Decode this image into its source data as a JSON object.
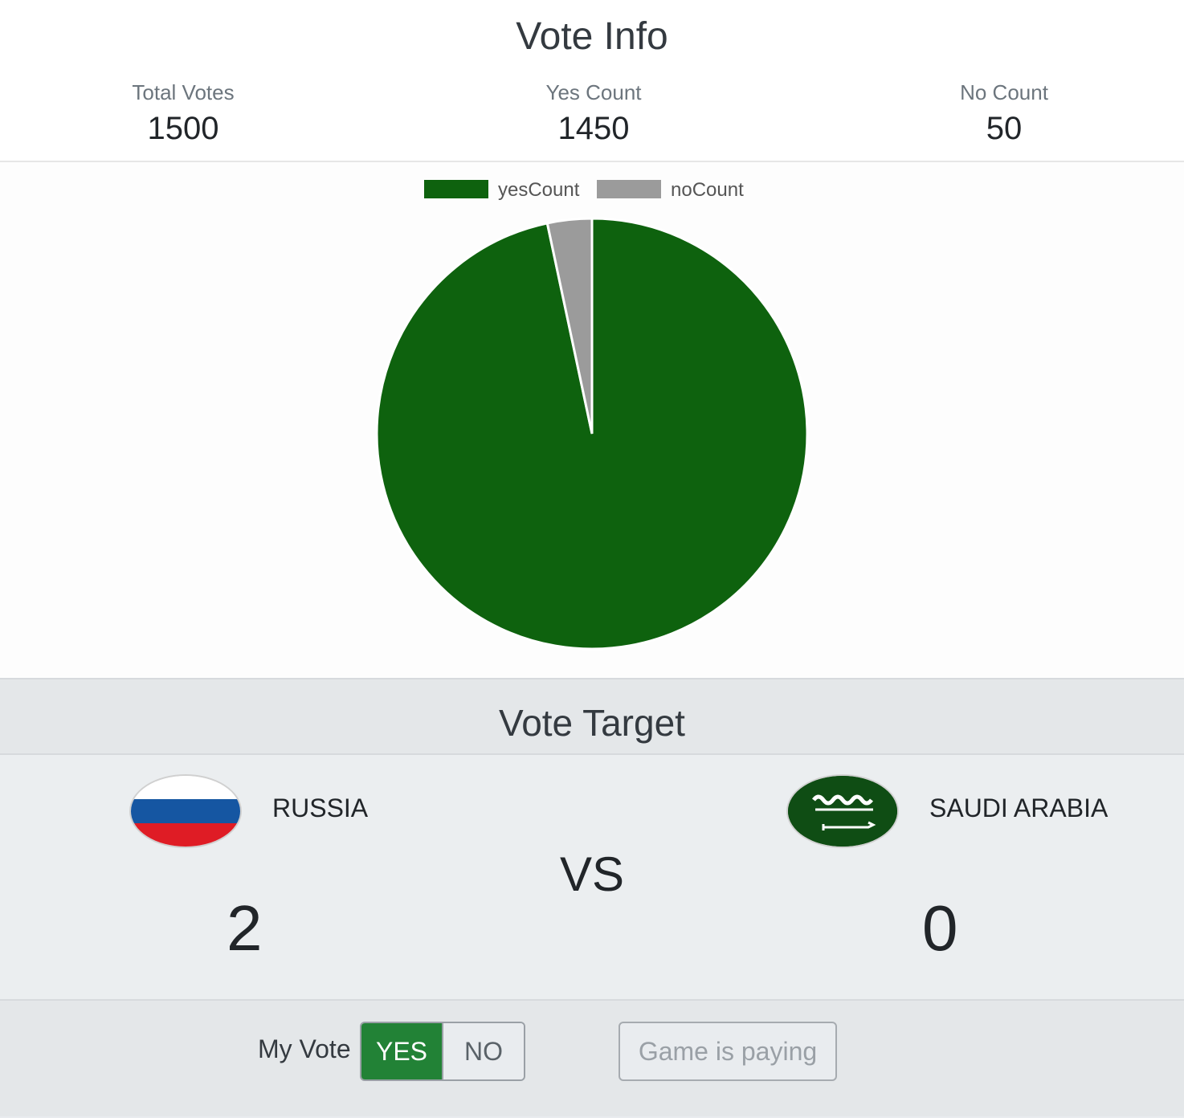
{
  "vote_info": {
    "title": "Vote Info",
    "stats": {
      "total": {
        "label": "Total Votes",
        "value": "1500"
      },
      "yes": {
        "label": "Yes Count",
        "value": "1450"
      },
      "no": {
        "label": "No Count",
        "value": "50"
      }
    }
  },
  "chart_data": {
    "type": "pie",
    "categories": [
      "yesCount",
      "noCount"
    ],
    "values": [
      1450,
      50
    ],
    "colors": [
      "#0e620e",
      "#9b9b9b"
    ],
    "legend": "top"
  },
  "vote_target": {
    "title": "Vote Target",
    "vs_label": "VS",
    "team_a": {
      "name": "RUSSIA",
      "score": "2",
      "flag": "russia-flag-icon"
    },
    "team_b": {
      "name": "SAUDI ARABIA",
      "score": "0",
      "flag": "saudi-arabia-flag-icon"
    }
  },
  "my_vote": {
    "label": "My Vote",
    "yes_label": "YES",
    "no_label": "NO",
    "selected": "YES",
    "status_label": "Game is paying"
  }
}
